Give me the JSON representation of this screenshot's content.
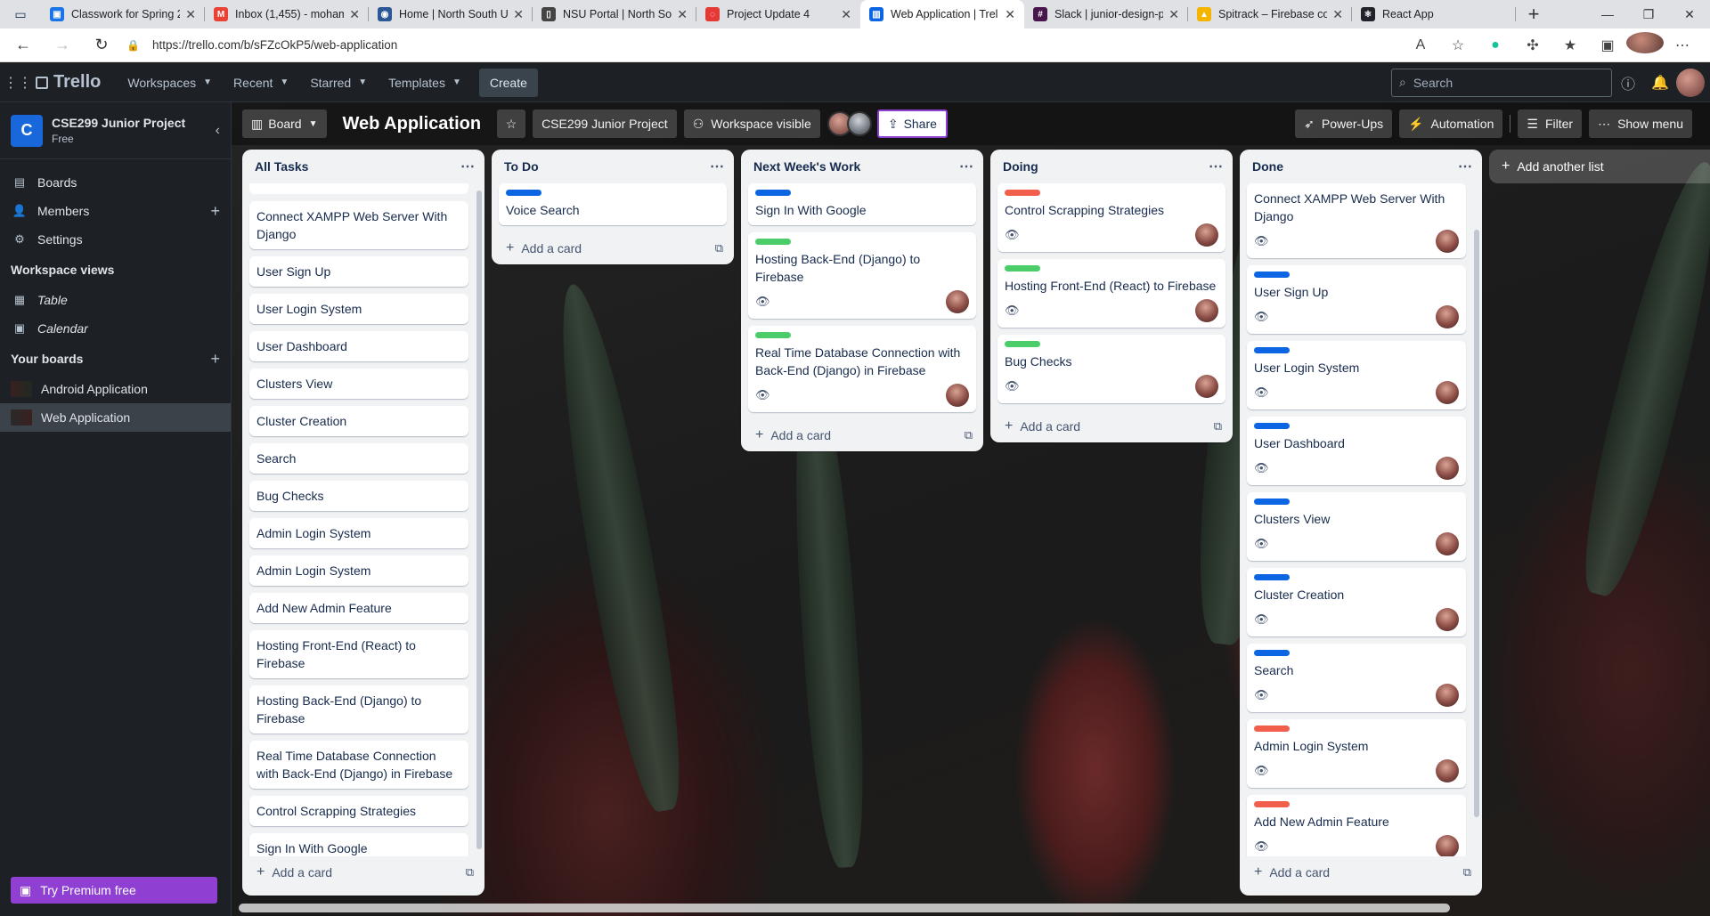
{
  "browser": {
    "tabs": [
      {
        "title": "Classwork for Spring 2",
        "icon": "classroom-icon",
        "color": "#1a73e8"
      },
      {
        "title": "Inbox (1,455) - moham",
        "icon": "gmail-icon",
        "color": "#ea4335"
      },
      {
        "title": "Home | North South U",
        "icon": "nsu-icon",
        "color": "#2b5797"
      },
      {
        "title": "NSU Portal | North So",
        "icon": "document-icon",
        "color": "#444444"
      },
      {
        "title": "Project Update 4",
        "icon": "loading-icon",
        "color": "#e53935"
      },
      {
        "title": "Web Application | Trel",
        "icon": "trello-icon",
        "color": "#0c66e4"
      },
      {
        "title": "Slack | junior-design-p",
        "icon": "slack-icon",
        "color": "#4a154b"
      },
      {
        "title": "Spitrack – Firebase co",
        "icon": "firebase-icon",
        "color": "#f4b400"
      },
      {
        "title": "React App",
        "icon": "react-icon",
        "color": "#20232a"
      }
    ],
    "url": "https://trello.com/b/sFZcOkP5/web-application"
  },
  "header": {
    "logo": "Trello",
    "menus": [
      "Workspaces",
      "Recent",
      "Starred",
      "Templates"
    ],
    "create": "Create",
    "search_placeholder": "Search"
  },
  "sidebar": {
    "workspace_initial": "C",
    "workspace_name": "CSE299 Junior Project",
    "workspace_plan": "Free",
    "items": [
      {
        "label": "Boards",
        "icon": "board-icon"
      },
      {
        "label": "Members",
        "icon": "members-icon"
      },
      {
        "label": "Settings",
        "icon": "gear-icon"
      }
    ],
    "views_title": "Workspace views",
    "views": [
      {
        "label": "Table",
        "icon": "table-icon"
      },
      {
        "label": "Calendar",
        "icon": "calendar-icon"
      }
    ],
    "boards_title": "Your boards",
    "boards": [
      {
        "label": "Android Application",
        "active": false
      },
      {
        "label": "Web Application",
        "active": true
      }
    ],
    "premium": "Try Premium free"
  },
  "board": {
    "view": "Board",
    "title": "Web Application",
    "workspace": "CSE299 Junior Project",
    "visibility": "Workspace visible",
    "share": "Share",
    "powerups": "Power-Ups",
    "automation": "Automation",
    "filter": "Filter",
    "show_menu": "Show menu",
    "add_list": "Add another list",
    "add_card": "Add a card"
  },
  "lists": [
    {
      "title": "All Tasks",
      "cards": [
        {
          "text": "Connect XAMPP Web Server With Django"
        },
        {
          "text": "User Sign Up"
        },
        {
          "text": "User Login System"
        },
        {
          "text": "User Dashboard"
        },
        {
          "text": "Clusters View"
        },
        {
          "text": "Cluster Creation"
        },
        {
          "text": "Search"
        },
        {
          "text": "Bug Checks"
        },
        {
          "text": "Admin Login System"
        },
        {
          "text": "Admin Login System"
        },
        {
          "text": "Add New Admin Feature"
        },
        {
          "text": "Hosting Front-End (React) to Firebase"
        },
        {
          "text": "Hosting Back-End (Django) to Firebase"
        },
        {
          "text": "Real Time Database Connection with Back-End (Django) in Firebase"
        },
        {
          "text": "Control Scrapping Strategies"
        },
        {
          "text": "Sign In With Google"
        },
        {
          "text": "Voice Search"
        }
      ]
    },
    {
      "title": "To Do",
      "cards": [
        {
          "text": "Voice Search",
          "label": "#0c66e4"
        }
      ]
    },
    {
      "title": "Next Week's Work",
      "cards": [
        {
          "text": "Sign In With Google",
          "label": "#0c66e4"
        },
        {
          "text": "Hosting Back-End (Django) to Firebase",
          "label": "#4bce6a",
          "meta": true
        },
        {
          "text": "Real Time Database Connection with Back-End (Django) in Firebase",
          "label": "#4bce6a",
          "meta": true
        }
      ]
    },
    {
      "title": "Doing",
      "cards": [
        {
          "text": "Control Scrapping Strategies",
          "label": "#f15f4c",
          "meta": true
        },
        {
          "text": "Hosting Front-End (React) to Firebase",
          "label": "#4bce6a",
          "meta": true
        },
        {
          "text": "Bug Checks",
          "label": "#4bce6a",
          "meta": true
        }
      ]
    },
    {
      "title": "Done",
      "cards": [
        {
          "text": "Connect XAMPP Web Server With Django",
          "meta": true
        },
        {
          "text": "User Sign Up",
          "label": "#0c66e4",
          "meta": true
        },
        {
          "text": "User Login System",
          "label": "#0c66e4",
          "meta": true
        },
        {
          "text": "User Dashboard",
          "label": "#0c66e4",
          "meta": true
        },
        {
          "text": "Clusters View",
          "label": "#0c66e4",
          "meta": true
        },
        {
          "text": "Cluster Creation",
          "label": "#0c66e4",
          "meta": true
        },
        {
          "text": "Search",
          "label": "#0c66e4",
          "meta": true
        },
        {
          "text": "Admin Login System",
          "label": "#f15f4c",
          "meta": true
        },
        {
          "text": "Add New Admin Feature",
          "label": "#f15f4c",
          "meta": true
        }
      ]
    }
  ]
}
